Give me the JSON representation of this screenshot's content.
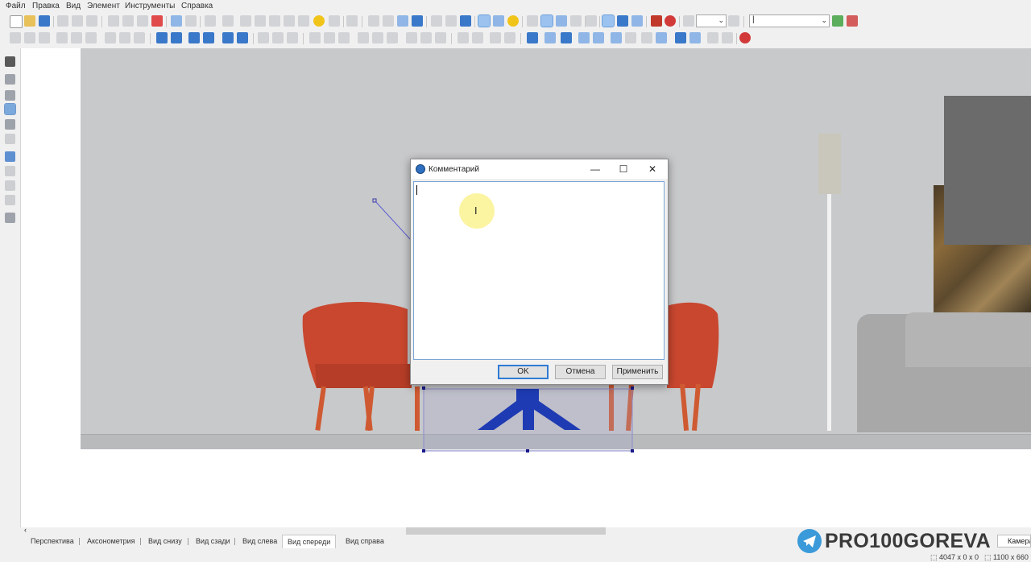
{
  "menu": {
    "file": "Файл",
    "edit": "Правка",
    "view": "Вид",
    "element": "Элемент",
    "tools": "Инструменты",
    "help": "Справка"
  },
  "toolbar": {
    "zoom_value": "",
    "layer_value": "|"
  },
  "dialog": {
    "title": "Комментарий",
    "text_value": "",
    "ok": "OK",
    "cancel": "Отмена",
    "apply": "Применить",
    "minimize": "—",
    "maximize": "☐",
    "close": "✕"
  },
  "view_tabs": [
    "Перспектива",
    "Аксонометрия",
    "Вид снизу",
    "Вид сзади",
    "Вид слева",
    "Вид спереди",
    "Вид справа"
  ],
  "active_tab": "Вид спереди",
  "watermark": "PRO100GOREVA",
  "status": {
    "camera": "Камера",
    "size1": "4047 x 0 x 0",
    "size2": "1100 x 660"
  },
  "colors": {
    "accent": "#2f7bd4",
    "chair": "#c9472f",
    "table_base": "#1f3bb3",
    "wall": "#c8c9cb"
  }
}
